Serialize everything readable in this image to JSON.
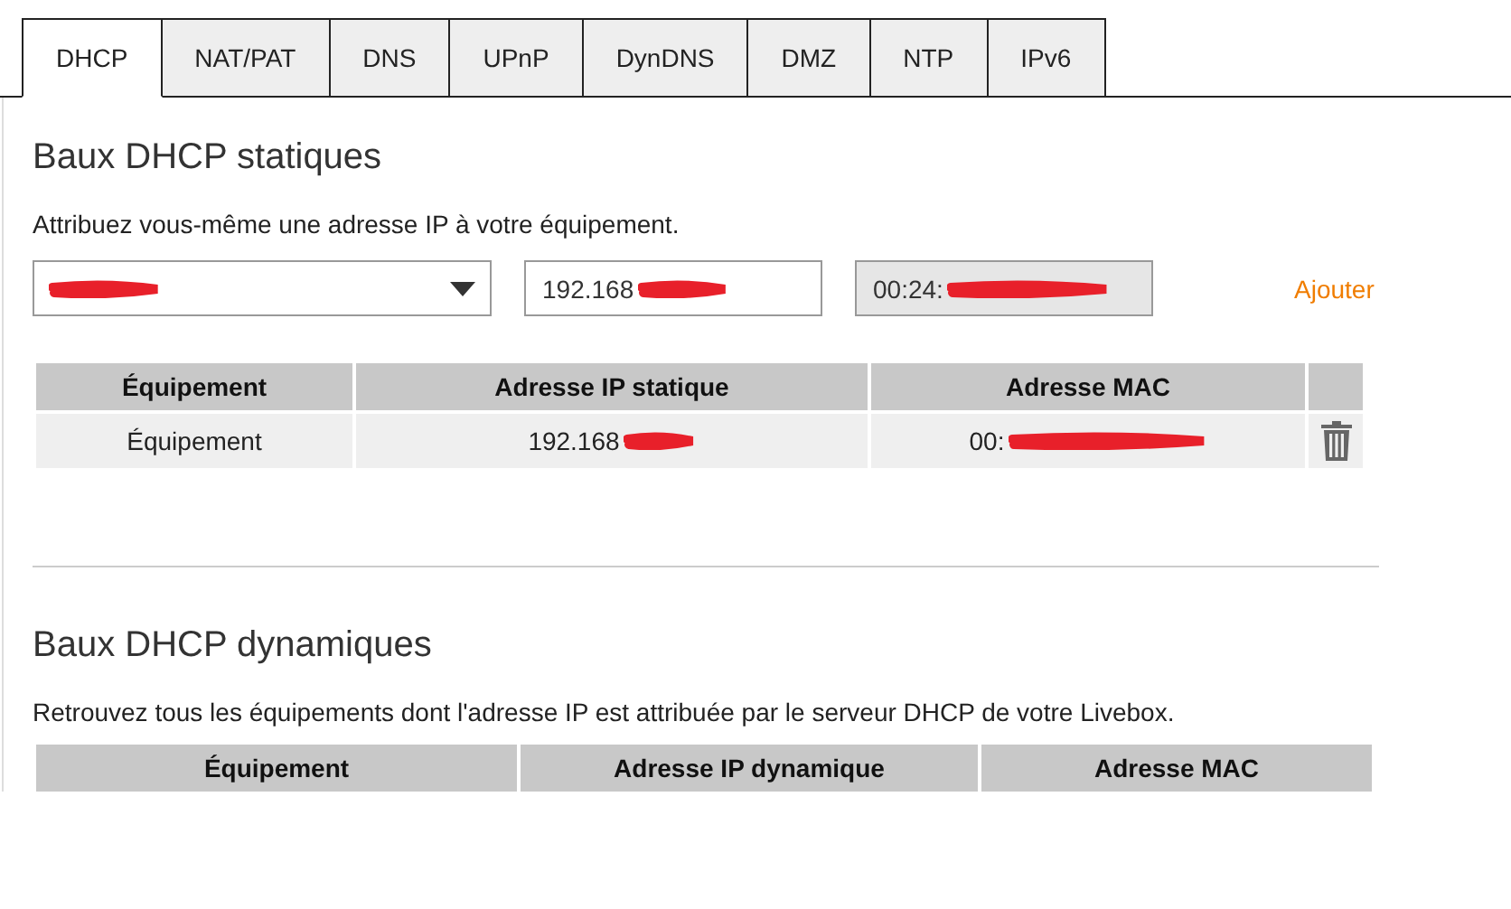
{
  "tabs": [
    {
      "label": "DHCP",
      "selected": true
    },
    {
      "label": "NAT/PAT",
      "selected": false
    },
    {
      "label": "DNS",
      "selected": false
    },
    {
      "label": "UPnP",
      "selected": false
    },
    {
      "label": "DynDNS",
      "selected": false
    },
    {
      "label": "DMZ",
      "selected": false
    },
    {
      "label": "NTP",
      "selected": false
    },
    {
      "label": "IPv6",
      "selected": false
    }
  ],
  "static_leases": {
    "title": "Baux DHCP statiques",
    "description": "Attribuez vous-même une adresse IP à votre équipement.",
    "ip_field": {
      "value": "192.168"
    },
    "mac_field": {
      "value": "00:24:"
    },
    "add_link": "Ajouter",
    "columns": [
      "Équipement",
      "Adresse IP statique",
      "Adresse MAC"
    ],
    "rows": [
      {
        "device": "Équipement",
        "ip": "192.168",
        "mac": "00:"
      }
    ]
  },
  "dynamic_leases": {
    "title": "Baux DHCP dynamiques",
    "description": "Retrouvez tous les équipements dont l'adresse IP est attribuée par le serveur DHCP de votre Livebox.",
    "columns": [
      "Équipement",
      "Adresse IP dynamique",
      "Adresse MAC"
    ]
  }
}
